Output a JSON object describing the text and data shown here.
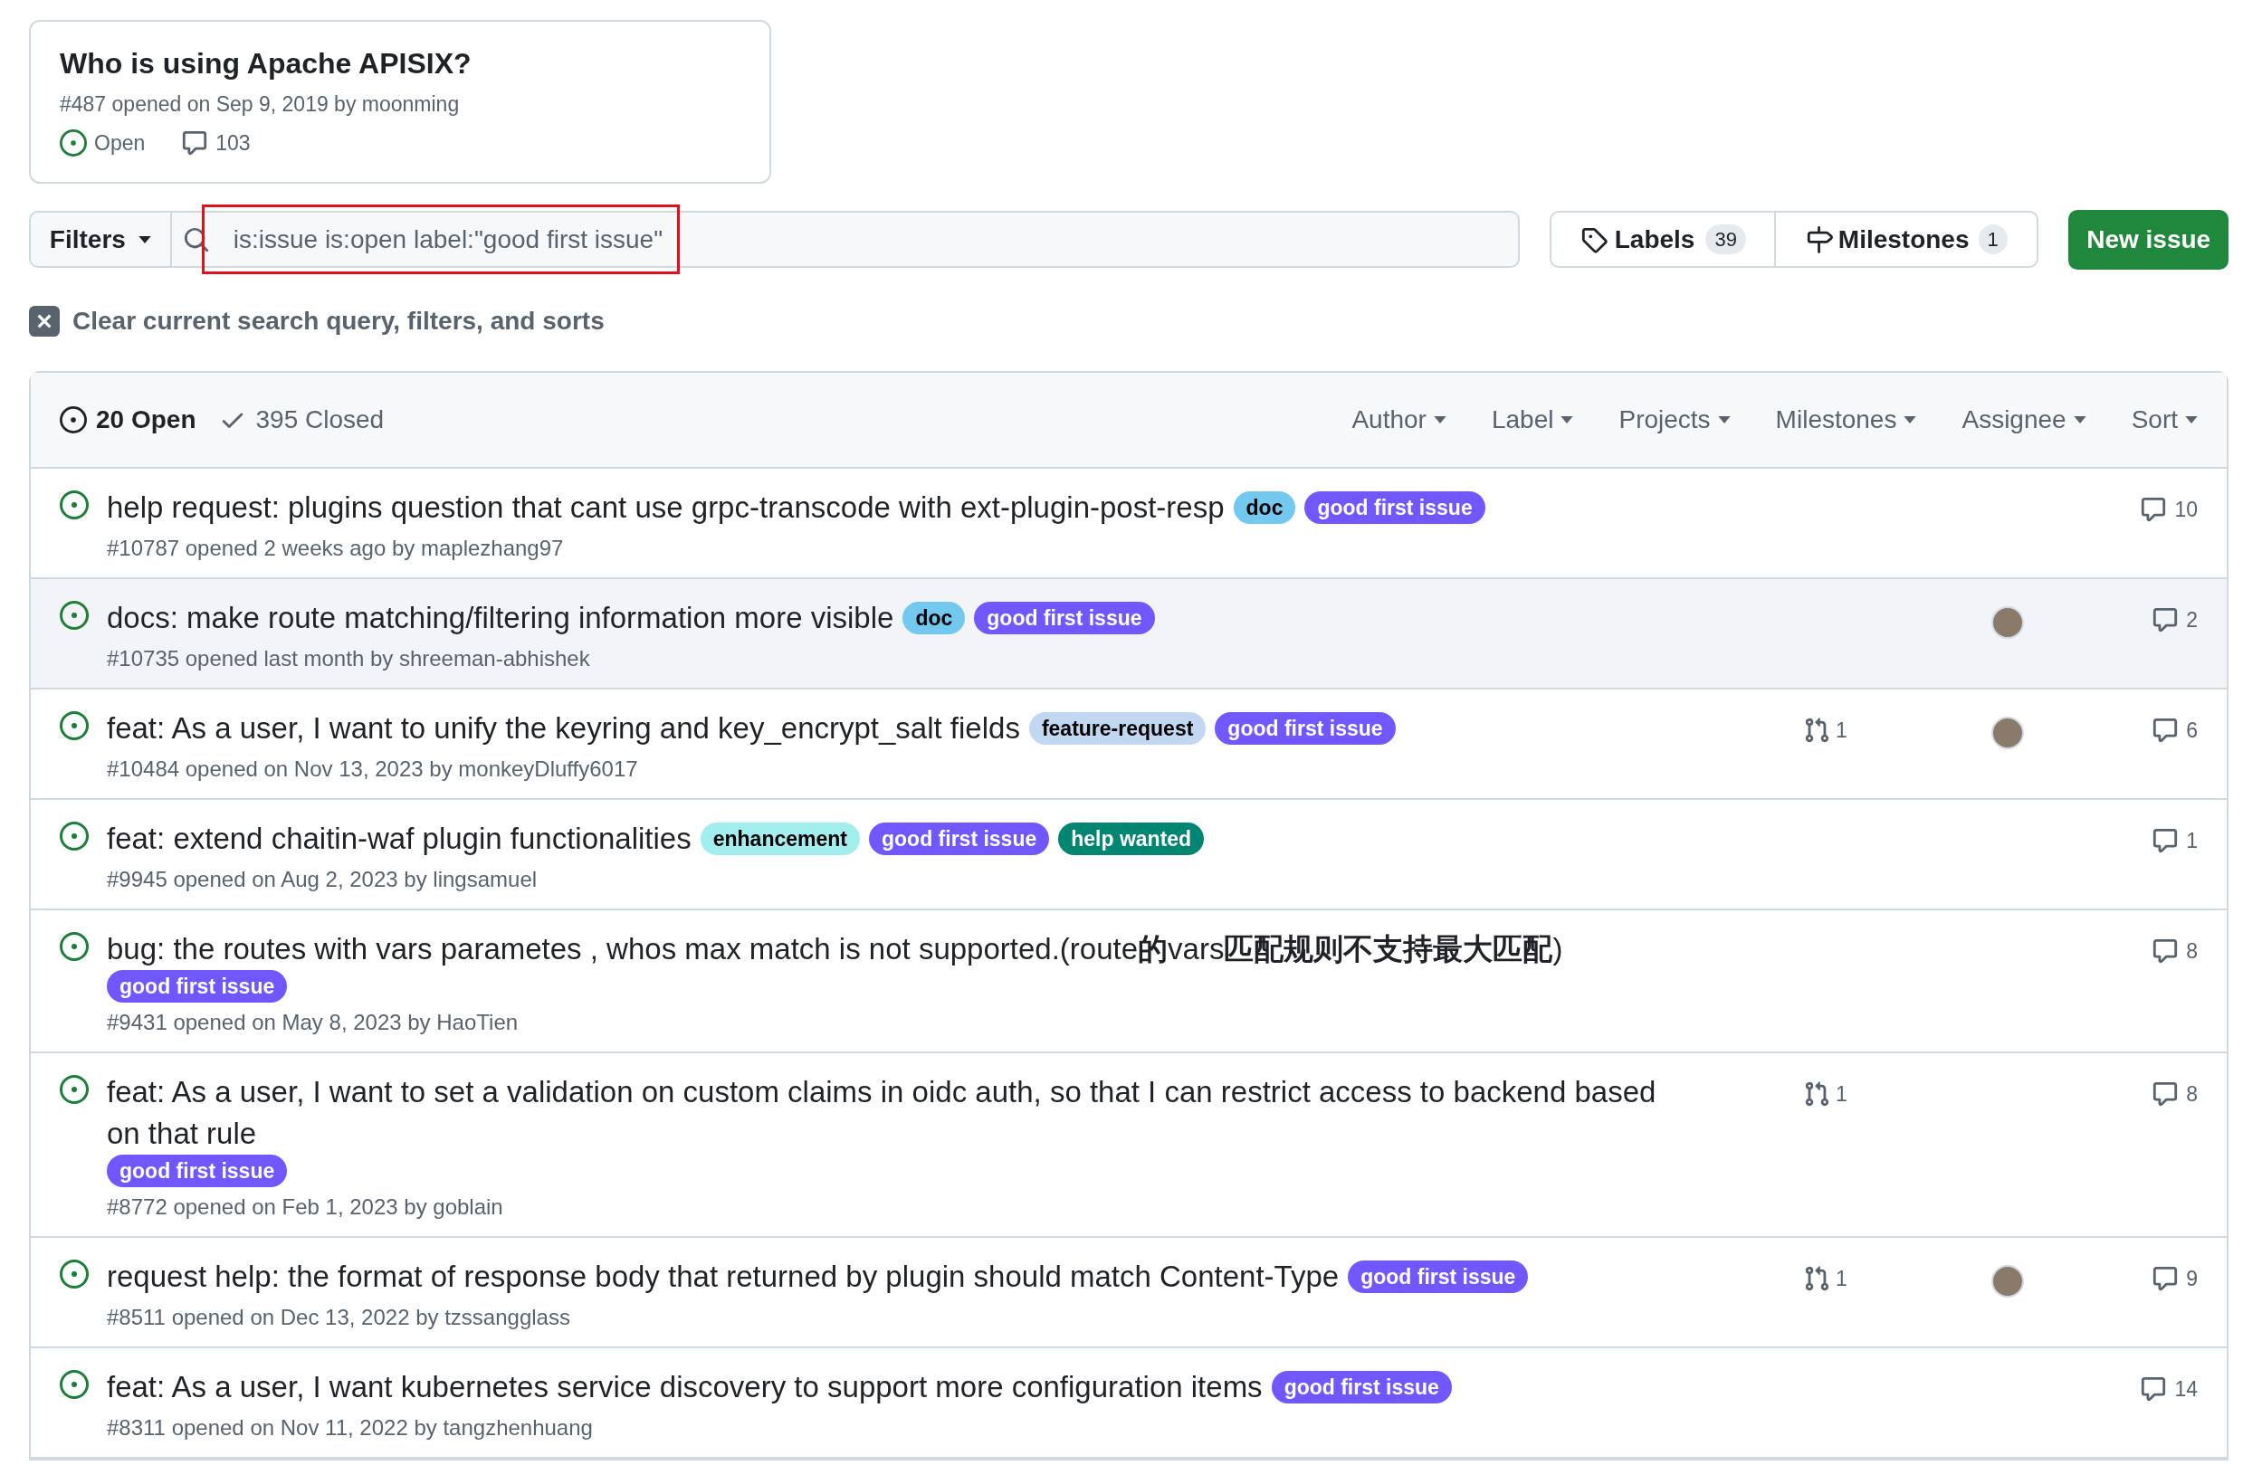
{
  "pinned_issue": {
    "title": "Who is using Apache APISIX?",
    "meta": "#487 opened on Sep 9, 2019 by moonming",
    "state": "Open",
    "comments": "103"
  },
  "search": {
    "filters_button": "Filters",
    "query": "is:issue is:open label:\"good first issue\"",
    "highlighted": true
  },
  "labels_button": {
    "label": "Labels",
    "count": "39"
  },
  "milestones_button": {
    "label": "Milestones",
    "count": "1"
  },
  "new_issue_button": "New issue",
  "clear_filters": "Clear current search query, filters, and sorts",
  "tabs": [
    {
      "label": "20 Open",
      "kind": "open",
      "selected": true
    },
    {
      "label": "395 Closed",
      "kind": "closed",
      "selected": false
    }
  ],
  "filter_menus": [
    "Author",
    "Label",
    "Projects",
    "Milestones",
    "Assignee",
    "Sort"
  ],
  "issues": [
    {
      "title": "help request: plugins question that cant use grpc-transcode with ext-plugin-post-resp",
      "labels": [
        {
          "name": "doc",
          "color": "#73c8f0"
        },
        {
          "name": "good first issue",
          "color": "#7057ff"
        }
      ],
      "meta": "#10787 opened 2 weeks ago by maplezhang97",
      "comments": "10",
      "hovered": false
    },
    {
      "title": "docs: make route matching/filtering information more visible",
      "labels": [
        {
          "name": "doc",
          "color": "#73c8f0"
        },
        {
          "name": "good first issue",
          "color": "#7057ff"
        }
      ],
      "meta": "#10735 opened last month by shreeman-abhishek",
      "assignee_avatar": true,
      "comments": "2",
      "hovered": true
    },
    {
      "title": "feat: As a user, I want to unify the keyring and key_encrypt_salt fields",
      "labels": [
        {
          "name": "feature-request",
          "color": "#c2d7f1"
        },
        {
          "name": "good first issue",
          "color": "#7057ff"
        }
      ],
      "meta": "#10484 opened on Nov 13, 2023 by monkeyDluffy6017",
      "linked_prs": "1",
      "assignee_avatar": true,
      "comments": "6",
      "hovered": false
    },
    {
      "title": "feat: extend chaitin-waf plugin functionalities",
      "labels": [
        {
          "name": "enhancement",
          "color": "#a2eeef"
        },
        {
          "name": "good first issue",
          "color": "#7057ff"
        },
        {
          "name": "help wanted",
          "color": "#008672"
        }
      ],
      "meta": "#9945 opened on Aug 2, 2023 by lingsamuel",
      "comments": "1",
      "hovered": false
    },
    {
      "title": "bug: the routes with vars parametes , whos max match is not supported.(route**的**vars**匹配规则不支持最大匹配**)",
      "labels": [
        {
          "name": "good first issue",
          "color": "#7057ff"
        }
      ],
      "meta": "#9431 opened on May 8, 2023 by HaoTien",
      "comments": "8",
      "hovered": false
    },
    {
      "title": "feat: As a user, I want to set a validation on custom claims in oidc auth, so that I can restrict access to backend based on that rule",
      "labels": [
        {
          "name": "good first issue",
          "color": "#7057ff"
        }
      ],
      "meta": "#8772 opened on Feb 1, 2023 by goblain",
      "linked_prs": "1",
      "comments": "8",
      "hovered": false
    },
    {
      "title": "request help: the format of response body that returned by plugin should match Content-Type",
      "labels": [
        {
          "name": "good first issue",
          "color": "#7057ff"
        }
      ],
      "meta": "#8511 opened on Dec 13, 2022 by tzssangglass",
      "linked_prs": "1",
      "assignee_avatar": true,
      "comments": "9",
      "hovered": false
    },
    {
      "title": "feat: As a user, I want kubernetes service discovery to support more configuration items",
      "labels": [
        {
          "name": "good first issue",
          "color": "#7057ff"
        }
      ],
      "meta": "#8311 opened on Nov 11, 2022 by tangzhenhuang",
      "comments": "14",
      "hovered": false
    }
  ]
}
